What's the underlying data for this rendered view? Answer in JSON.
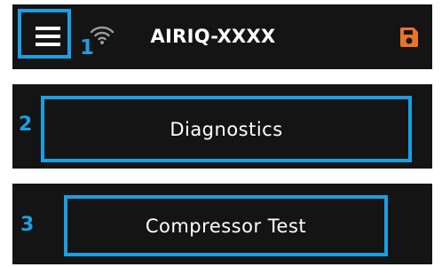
{
  "header": {
    "title": "AIRIQ-XXXX",
    "menu_icon": "hamburger-icon",
    "wifi_icon": "wifi-icon",
    "save_icon": "save-icon",
    "save_color": "#e8732a"
  },
  "steps": {
    "one": "1",
    "two": "2",
    "three": "3"
  },
  "buttons": {
    "diagnostics": "Diagnostics",
    "compressor_test": "Compressor Test"
  },
  "colors": {
    "highlight": "#1a9fe2",
    "panel": "#141414",
    "text": "#ffffff"
  }
}
